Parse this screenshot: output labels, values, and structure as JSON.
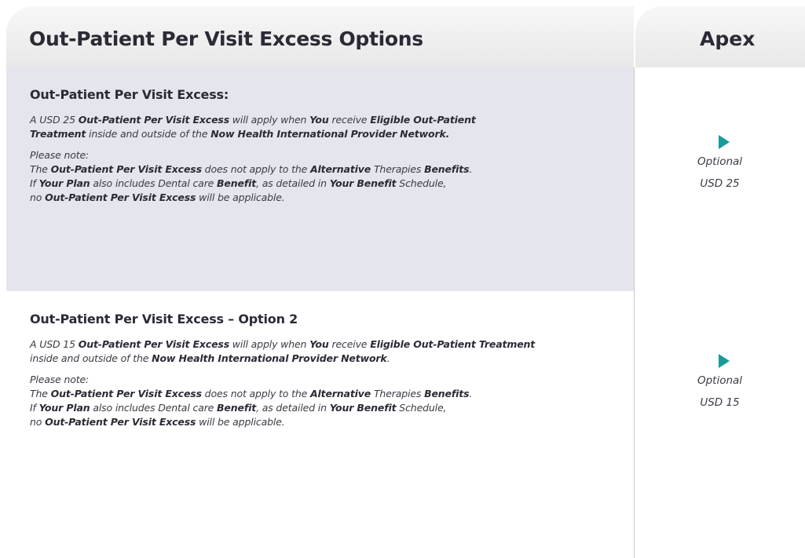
{
  "header": {
    "title": "Out-Patient Per Visit Excess Options",
    "column": "Apex"
  },
  "sections": [
    {
      "title": "Out-Patient Per Visit Excess:",
      "main": [
        [
          [
            "A USD 25 ",
            false
          ],
          [
            "Out-Patient Per Visit Excess",
            true
          ],
          [
            " will apply when ",
            false
          ],
          [
            "You",
            true
          ],
          [
            " receive ",
            false
          ],
          [
            "Eligible Out-Patient",
            true
          ]
        ],
        [
          [
            "Treatment",
            true
          ],
          [
            " inside and outside of the ",
            false
          ],
          [
            "Now Health International Provider Network.",
            true
          ]
        ]
      ],
      "note": [
        [
          [
            "Please note:",
            false
          ]
        ],
        [
          [
            "The ",
            false
          ],
          [
            "Out-Patient Per Visit Excess",
            true
          ],
          [
            " does not apply to the ",
            false
          ],
          [
            "Alternative",
            true
          ],
          [
            " Therapies ",
            false
          ],
          [
            "Benefits",
            true
          ],
          [
            ".",
            false
          ]
        ],
        [
          [
            "If ",
            false
          ],
          [
            "Your Plan",
            true
          ],
          [
            " also includes Dental care ",
            false
          ],
          [
            "Benefit",
            true
          ],
          [
            ", as detailed in ",
            false
          ],
          [
            "Your Benefit",
            true
          ],
          [
            " Schedule,",
            false
          ]
        ],
        [
          [
            "no ",
            false
          ],
          [
            "Out-Patient Per Visit Excess",
            true
          ],
          [
            " will be applicable.",
            false
          ]
        ]
      ],
      "option_label": "Optional",
      "option_value": "USD 25"
    },
    {
      "title": "Out-Patient Per Visit Excess – Option 2",
      "main": [
        [
          [
            "A USD 15 ",
            false
          ],
          [
            "Out-Patient Per Visit Excess",
            true
          ],
          [
            " will apply when ",
            false
          ],
          [
            "You",
            true
          ],
          [
            " receive ",
            false
          ],
          [
            "Eligible Out-Patient Treatment",
            true
          ]
        ],
        [
          [
            "inside and outside of the ",
            false
          ],
          [
            "Now Health International Provider Network",
            true
          ],
          [
            ".",
            false
          ]
        ]
      ],
      "note": [
        [
          [
            "Please note:",
            false
          ]
        ],
        [
          [
            "The ",
            false
          ],
          [
            "Out-Patient Per Visit Excess",
            true
          ],
          [
            " does not apply to the ",
            false
          ],
          [
            "Alternative",
            true
          ],
          [
            " Therapies ",
            false
          ],
          [
            "Benefits",
            true
          ],
          [
            ".",
            false
          ]
        ],
        [
          [
            "If ",
            false
          ],
          [
            "Your Plan",
            true
          ],
          [
            " also includes Dental care ",
            false
          ],
          [
            "Benefit",
            true
          ],
          [
            ", as detailed in ",
            false
          ],
          [
            "Your Benefit",
            true
          ],
          [
            " Schedule,",
            false
          ]
        ],
        [
          [
            "no ",
            false
          ],
          [
            "Out-Patient Per Visit Excess",
            true
          ],
          [
            " will be applicable.",
            false
          ]
        ]
      ],
      "option_label": "Optional",
      "option_value": "USD 15"
    }
  ],
  "colors": {
    "accent": "#1a9a9a",
    "row_shade": "#e5e5ed",
    "header_bg": "#eeeeee"
  },
  "icons": {
    "option_marker": "play-arrow-icon"
  }
}
